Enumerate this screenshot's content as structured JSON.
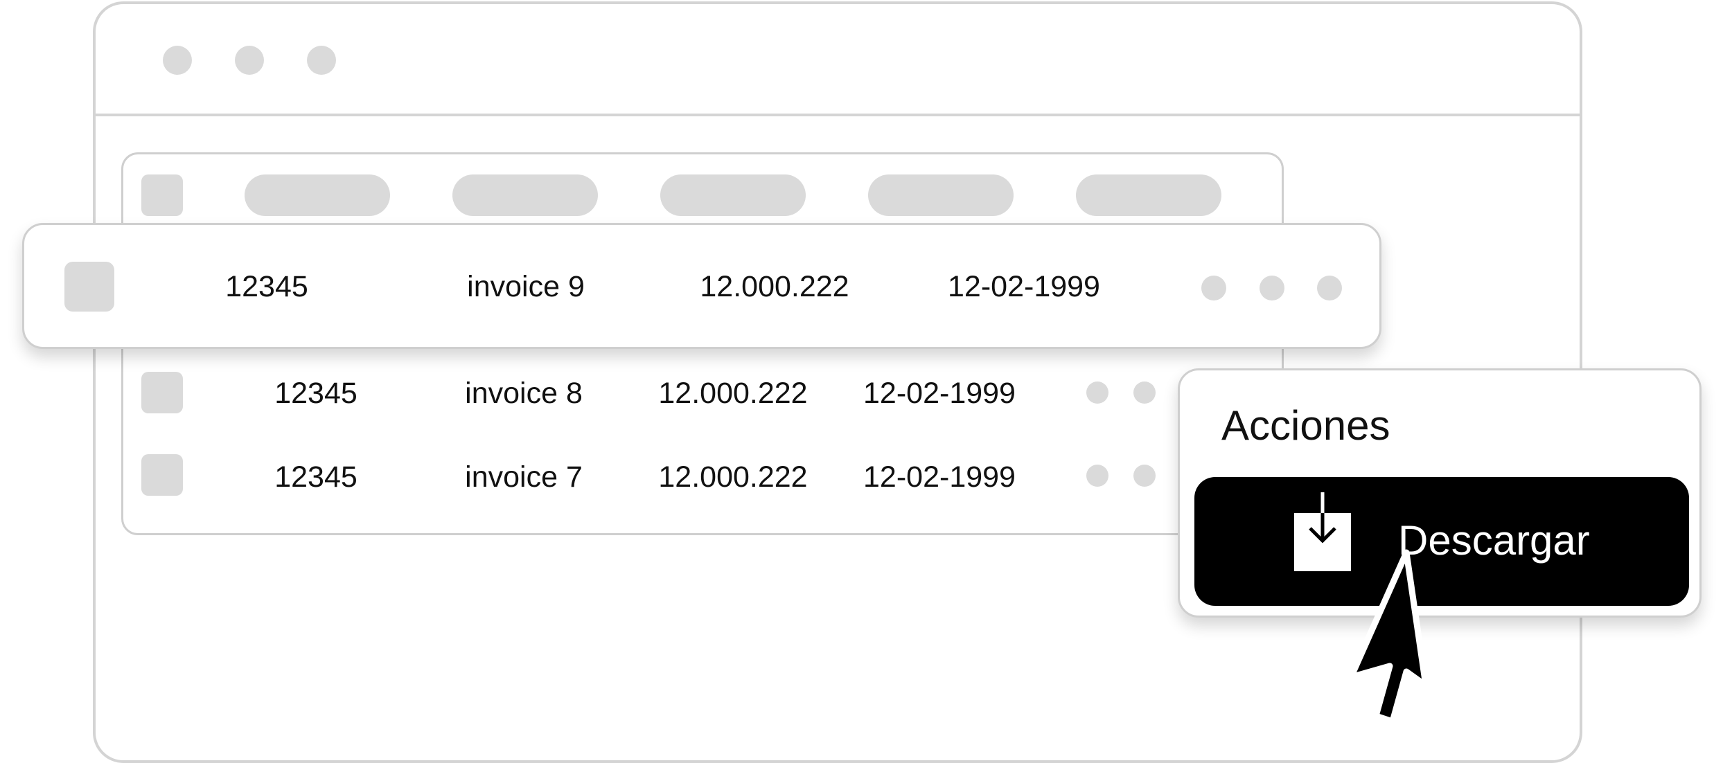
{
  "table": {
    "rows": [
      {
        "id": "12345",
        "name": "invoice 9",
        "amount": "12.000.222",
        "date": "12-02-1999"
      },
      {
        "id": "12345",
        "name": "invoice 8",
        "amount": "12.000.222",
        "date": "12-02-1999"
      },
      {
        "id": "12345",
        "name": "invoice 7",
        "amount": "12.000.222",
        "date": "12-02-1999"
      }
    ]
  },
  "actions_menu": {
    "title": "Acciones",
    "download_label": "Descargar",
    "download_icon": "download-icon"
  },
  "colors": {
    "placeholder_gray": "#dadada",
    "border_gray": "#cfcfcf",
    "button_bg": "#000000",
    "button_text": "#ffffff"
  }
}
